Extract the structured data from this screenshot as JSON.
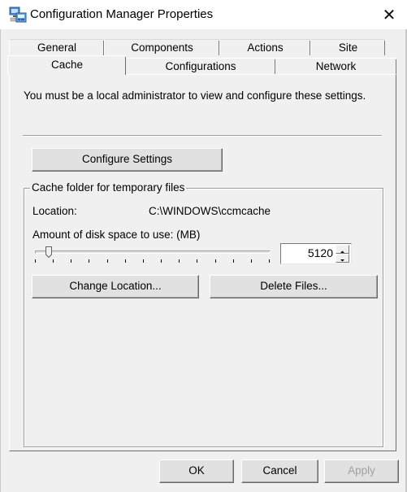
{
  "window": {
    "title": "Configuration Manager Properties",
    "app_icon": "config-manager-icon",
    "close_glyph": "✕"
  },
  "tabs": {
    "back_row": [
      {
        "label": "General"
      },
      {
        "label": "Components"
      },
      {
        "label": "Actions"
      },
      {
        "label": "Site"
      }
    ],
    "front_row": [
      {
        "label": "Cache",
        "selected": true
      },
      {
        "label": "Configurations"
      },
      {
        "label": "Network"
      }
    ]
  },
  "cache": {
    "notice": "You must be a local administrator to view and configure these settings.",
    "configure_button": "Configure Settings",
    "group_title": "Cache folder for temporary files",
    "location_label": "Location:",
    "location_value": "C:\\WINDOWS\\ccmcache",
    "disk_space_label": "Amount of disk space to use: (MB)",
    "disk_space_value": "5120",
    "slider_level": 0.04,
    "change_location_button": "Change Location...",
    "delete_files_button": "Delete Files..."
  },
  "footer": {
    "ok": "OK",
    "cancel": "Cancel",
    "apply": "Apply"
  },
  "colors": {
    "dialog_bg": "#f0f0f0",
    "button_bg": "#e1e1e1",
    "disabled_text": "#a0a0a0"
  }
}
